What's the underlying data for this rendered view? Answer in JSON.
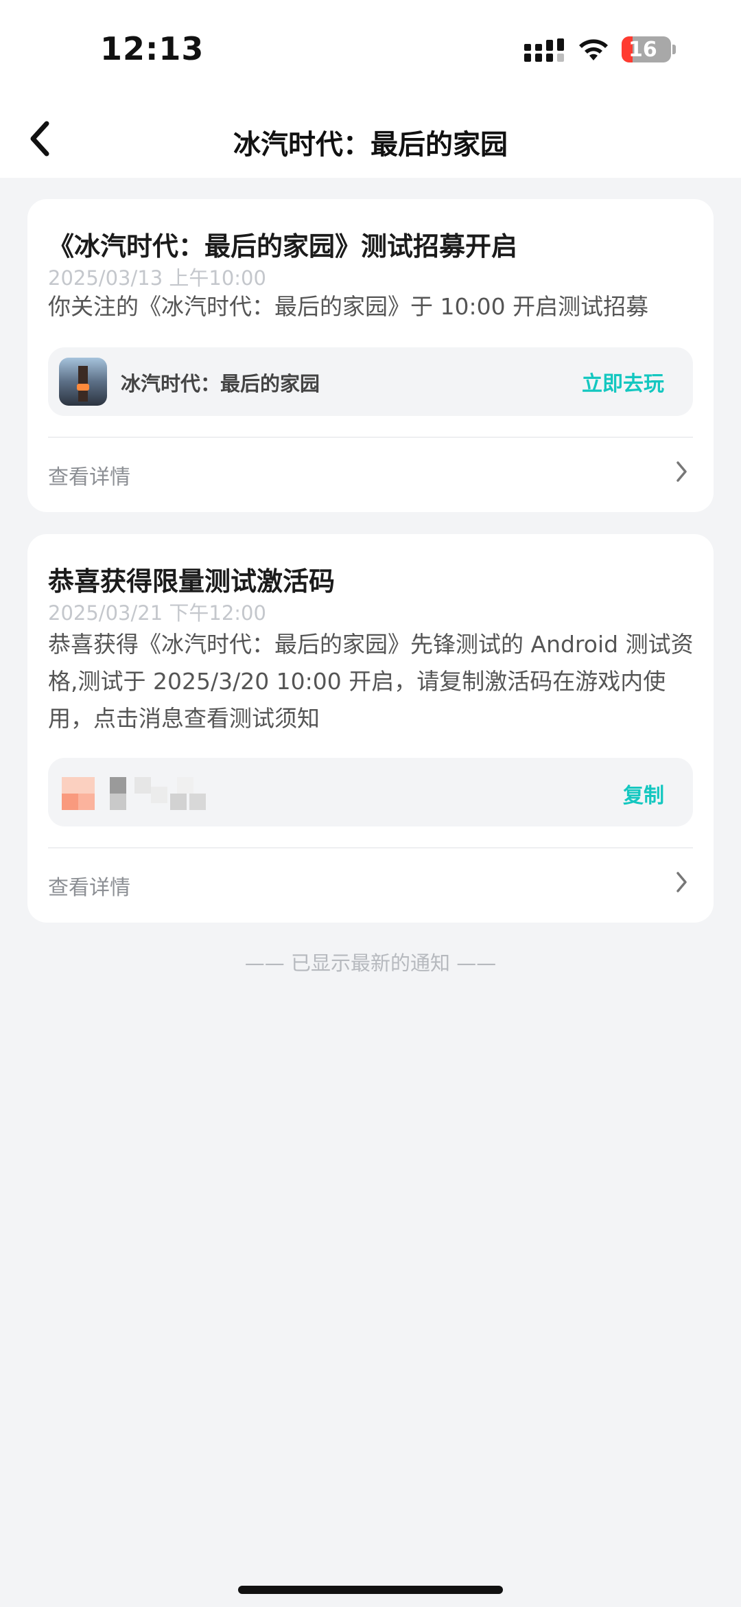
{
  "status_bar": {
    "time": "12:13",
    "battery": "16"
  },
  "nav": {
    "title": "冰汽时代：最后的家园"
  },
  "notifications": [
    {
      "title": "《冰汽时代：最后的家园》测试招募开启",
      "date": "2025/03/13 上午10:00",
      "body": "你关注的《冰汽时代：最后的家园》于 10:00 开启测试招募",
      "game_name": "冰汽时代：最后的家园",
      "action_label": "立即去玩",
      "detail_label": "查看详情"
    },
    {
      "title": "恭喜获得限量测试激活码",
      "date": "2025/03/21 下午12:00",
      "body": "恭喜获得《冰汽时代：最后的家园》先锋测试的 Android 测试资格,测试于 2025/3/20 10:00 开启，请复制激活码在游戏内使用，点击消息查看测试须知",
      "action_label": "复制",
      "detail_label": "查看详情"
    }
  ],
  "footer_note": "—— 已显示最新的通知 ——",
  "colors": {
    "accent": "#14c7c0",
    "background": "#f3f4f6",
    "battery_low": "#ff3b30"
  }
}
